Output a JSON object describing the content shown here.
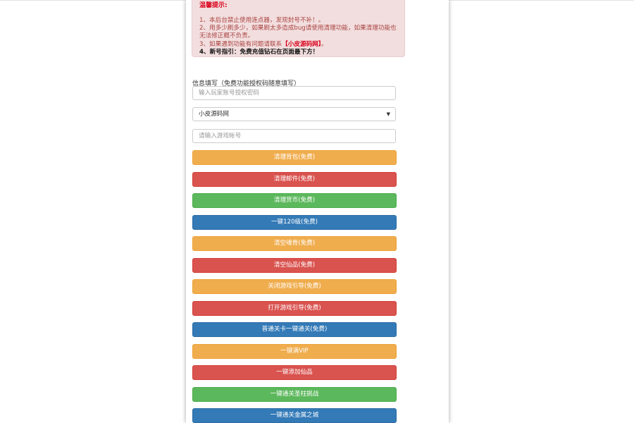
{
  "notice": {
    "title": "温馨提示:",
    "line1": "1、本后台禁止使用连点器，发现封号不补！。",
    "line2": "2、用多少刷多少，如果刷太多造成bug请使用清理功能，如果清理功能也无法修正概不负责。",
    "line3_prefix": "3、如果遇到功能有问题请联系",
    "line3_contact": "【小皮源码网】",
    "line3_suffix": "。",
    "line4": "4、新号指引：免费充值钻石在页面最下方！"
  },
  "form": {
    "label": "信息填写（免费功能授权码随意填写）",
    "auth_placeholder": "输入玩家账号授权密码",
    "server_selected": "小皮源码网",
    "account_placeholder": "请输入游戏帐号"
  },
  "buttons": [
    {
      "label": "清理背包(免费)",
      "style": "warning"
    },
    {
      "label": "清理邮件(免费)",
      "style": "danger"
    },
    {
      "label": "清理货币(免费)",
      "style": "success"
    },
    {
      "label": "一键120级(免费)",
      "style": "primary"
    },
    {
      "label": "清空魂骨(免费)",
      "style": "warning"
    },
    {
      "label": "清空仙品(免费)",
      "style": "danger"
    },
    {
      "label": "关闭游戏引导(免费)",
      "style": "warning"
    },
    {
      "label": "打开游戏引导(免费)",
      "style": "danger"
    },
    {
      "label": "普通关卡一键通关(免费)",
      "style": "primary"
    },
    {
      "label": "一键满VIP",
      "style": "warning"
    },
    {
      "label": "一键添加仙品",
      "style": "danger"
    },
    {
      "label": "一键通关圣柱挑战",
      "style": "success"
    },
    {
      "label": "一键通关金属之城",
      "style": "primary"
    }
  ],
  "colors": {
    "warning": "#f0ad4e",
    "danger": "#d9534f",
    "success": "#5cb85c",
    "primary": "#337ab7",
    "notice_bg": "#f2dede"
  }
}
